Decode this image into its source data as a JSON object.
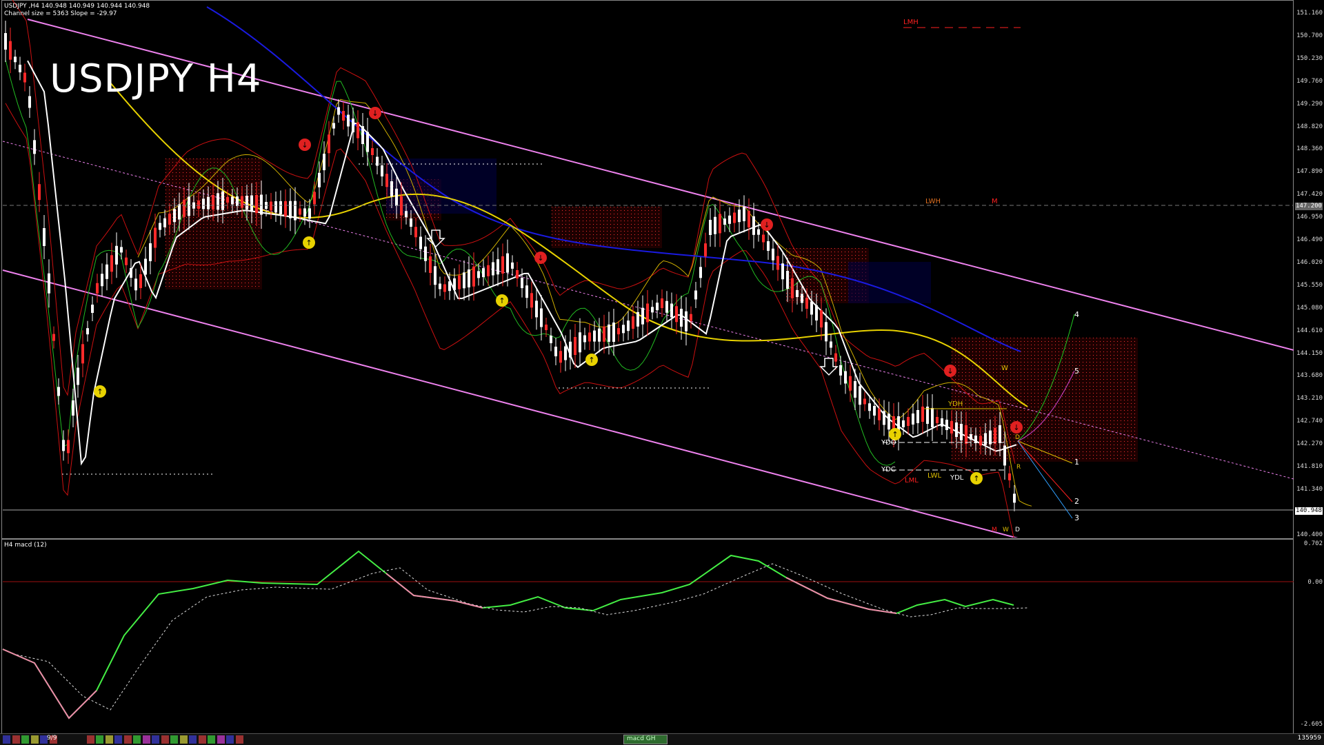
{
  "header": {
    "symbol_line": "USDJPY ,H4  140.948 140.949 140.944 140.948",
    "channel_line": "Channel size = 5363 Slope = -29.97"
  },
  "title": "USDJPY H4",
  "price_axis": {
    "ticks": [
      "151.160",
      "150.700",
      "150.230",
      "149.760",
      "149.290",
      "148.820",
      "148.360",
      "147.890",
      "147.420",
      "146.950",
      "146.490",
      "146.020",
      "145.550",
      "145.080",
      "144.610",
      "144.150",
      "143.680",
      "143.210",
      "142.740",
      "142.270",
      "141.810",
      "141.340",
      "140.870",
      "140.400"
    ],
    "current_price": "140.948",
    "level_147": "147.200"
  },
  "levels": {
    "lmh": "LMH",
    "lwh": "LWH",
    "m": "M",
    "w": "W",
    "ydh": "YDH",
    "ydo": "YDO",
    "ydc": "YDC",
    "lml": "LML",
    "lwl": "LWL",
    "ydl": "YDL",
    "d1": "D",
    "d2": "D",
    "r": "R",
    "bottom_m": "M",
    "bottom_w": "W",
    "bottom_d": "D"
  },
  "waves": [
    "1",
    "2",
    "3",
    "4",
    "5"
  ],
  "macd": {
    "label": "H4  macd (12)",
    "ticks": [
      "0.702",
      "0.00",
      "-2.605"
    ],
    "footer_value": "135959"
  },
  "footer": {
    "page": "9/9",
    "tab_label": "macd GH",
    "tab_colors": [
      "#3c3cc8",
      "#c83c3c",
      "#3cc83c",
      "#c8c83c",
      "#3c3cc8",
      "#c83c3c",
      "#3cc83c",
      "#c83cc8",
      "#3c3cc8",
      "#c83c3c",
      "#3cc83c",
      "#c8c83c",
      "#3c3cc8",
      "#c83c3c",
      "#3cc83c",
      "#c83cc8",
      "#3c3cc8",
      "#c83c3c",
      "#3cc83c",
      "#c8c83c",
      "#3c3cc8",
      "#c83c3c",
      "#3cc83c",
      "#c83cc8",
      "#3c3cc8",
      "#c83c3c"
    ]
  },
  "colors": {
    "up_candle": "#ffffff",
    "down_candle": "#ff2a2a",
    "channel": "#ee82ee",
    "cloud": "#ff3030",
    "ma_slow": "#1a1ae0",
    "ma_mid": "#e8d200",
    "ma_fast": "#ffffff",
    "macd_up": "#44ee44",
    "macd_down": "#ee88aa"
  }
}
